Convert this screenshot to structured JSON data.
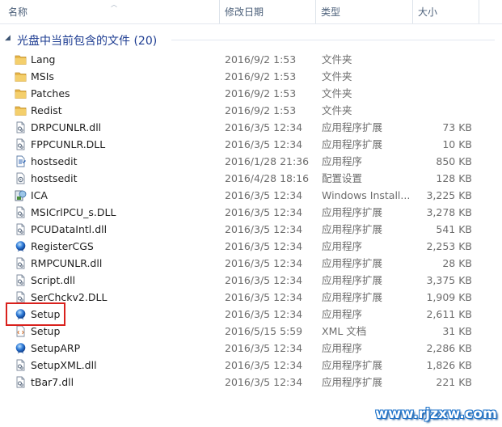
{
  "columns": {
    "name": "名称",
    "date": "修改日期",
    "type": "类型",
    "size": "大小"
  },
  "group": {
    "title": "光盘中当前包含的文件 (20)"
  },
  "files": [
    {
      "name": "Lang",
      "date": "2016/9/2 1:53",
      "type": "文件夹",
      "size": "",
      "icon": "folder-icon"
    },
    {
      "name": "MSIs",
      "date": "2016/9/2 1:53",
      "type": "文件夹",
      "size": "",
      "icon": "folder-icon"
    },
    {
      "name": "Patches",
      "date": "2016/9/2 1:53",
      "type": "文件夹",
      "size": "",
      "icon": "folder-icon"
    },
    {
      "name": "Redist",
      "date": "2016/9/2 1:53",
      "type": "文件夹",
      "size": "",
      "icon": "folder-icon"
    },
    {
      "name": "DRPCUNLR.dll",
      "date": "2016/3/5 12:34",
      "type": "应用程序扩展",
      "size": "73 KB",
      "icon": "dll-file-icon"
    },
    {
      "name": "FPPCUNLR.DLL",
      "date": "2016/3/5 12:34",
      "type": "应用程序扩展",
      "size": "10 KB",
      "icon": "dll-file-icon"
    },
    {
      "name": "hostsedit",
      "date": "2016/1/28 21:36",
      "type": "应用程序",
      "size": "850 KB",
      "icon": "application-icon"
    },
    {
      "name": "hostsedit",
      "date": "2016/4/28 18:16",
      "type": "配置设置",
      "size": "128 KB",
      "icon": "config-file-icon"
    },
    {
      "name": "ICA",
      "date": "2016/3/5 12:34",
      "type": "Windows Install...",
      "size": "3,225 KB",
      "icon": "installer-icon"
    },
    {
      "name": "MSICrlPCU_s.DLL",
      "date": "2016/3/5 12:34",
      "type": "应用程序扩展",
      "size": "3,278 KB",
      "icon": "dll-file-icon"
    },
    {
      "name": "PCUDataIntl.dll",
      "date": "2016/3/5 12:34",
      "type": "应用程序扩展",
      "size": "541 KB",
      "icon": "dll-file-icon"
    },
    {
      "name": "RegisterCGS",
      "date": "2016/3/5 12:34",
      "type": "应用程序",
      "size": "2,253 KB",
      "icon": "blue-orb-app-icon"
    },
    {
      "name": "RMPCUNLR.dll",
      "date": "2016/3/5 12:34",
      "type": "应用程序扩展",
      "size": "28 KB",
      "icon": "dll-file-icon"
    },
    {
      "name": "Script.dll",
      "date": "2016/3/5 12:34",
      "type": "应用程序扩展",
      "size": "3,375 KB",
      "icon": "dll-file-icon"
    },
    {
      "name": "SerChckv2.DLL",
      "date": "2016/3/5 12:34",
      "type": "应用程序扩展",
      "size": "1,909 KB",
      "icon": "dll-file-icon"
    },
    {
      "name": "Setup",
      "date": "2016/3/5 12:34",
      "type": "应用程序",
      "size": "2,611 KB",
      "icon": "blue-orb-app-icon"
    },
    {
      "name": "Setup",
      "date": "2016/5/15 5:59",
      "type": "XML 文档",
      "size": "31 KB",
      "icon": "xml-file-icon"
    },
    {
      "name": "SetupARP",
      "date": "2016/3/5 12:34",
      "type": "应用程序",
      "size": "2,286 KB",
      "icon": "blue-orb-app-icon"
    },
    {
      "name": "SetupXML.dll",
      "date": "2016/3/5 12:34",
      "type": "应用程序扩展",
      "size": "1,826 KB",
      "icon": "dll-file-icon"
    },
    {
      "name": "tBar7.dll",
      "date": "2016/3/5 12:34",
      "type": "应用程序扩展",
      "size": "221 KB",
      "icon": "dll-file-icon"
    }
  ],
  "watermark": "www.rjzxw.com",
  "colors": {
    "header_text": "#4c607a",
    "group_title": "#1e3d92",
    "highlight_border": "#d9211d",
    "folder": "#e8b74a",
    "watermark_outline": "#1b71c9"
  }
}
